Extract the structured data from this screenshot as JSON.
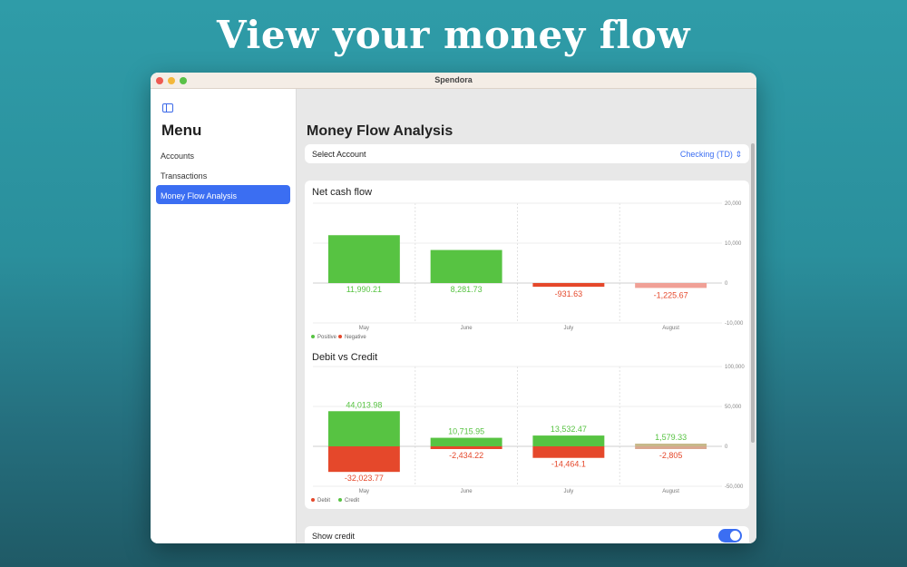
{
  "headline": "View your money flow",
  "window": {
    "title": "Spendora"
  },
  "sidebar": {
    "heading": "Menu",
    "items": [
      {
        "label": "Accounts"
      },
      {
        "label": "Transactions"
      },
      {
        "label": "Money Flow Analysis",
        "active": true
      }
    ]
  },
  "main": {
    "title": "Money Flow Analysis",
    "select_account": {
      "label": "Select Account",
      "value": "Checking (TD)"
    },
    "show_credit": {
      "label": "Show credit",
      "on": true
    }
  },
  "colors": {
    "positive": "#57c342",
    "negative": "#e5482b",
    "negative_light": "#f0a096",
    "accent": "#3b6ef2"
  },
  "chart_data": [
    {
      "type": "bar",
      "title": "Net cash flow",
      "categories": [
        "May",
        "June",
        "July",
        "August"
      ],
      "series": [
        {
          "name": "Net",
          "values": [
            11990.21,
            8281.73,
            -931.63,
            -1225.67
          ],
          "labels": [
            "11,990.21",
            "8,281.73",
            "-931.63",
            "-1,225.67"
          ]
        }
      ],
      "y_ticks": [
        20000,
        10000,
        0,
        -10000
      ],
      "y_tick_labels": [
        "20,000",
        "10,000",
        "0",
        "-10,000"
      ],
      "ylim": [
        -10000,
        20000
      ],
      "legend": [
        {
          "name": "Positive",
          "color": "#57c342"
        },
        {
          "name": "Negative",
          "color": "#e5482b"
        }
      ],
      "legend_position": "bottom-left",
      "grid": true
    },
    {
      "type": "bar",
      "title": "Debit vs Credit",
      "categories": [
        "May",
        "June",
        "July",
        "August"
      ],
      "series": [
        {
          "name": "Credit",
          "values": [
            44013.98,
            10715.95,
            13532.47,
            1579.33
          ],
          "labels": [
            "44,013.98",
            "10,715.95",
            "13,532.47",
            "1,579.33"
          ]
        },
        {
          "name": "Debit",
          "values": [
            -32023.77,
            -2434.22,
            -14464.1,
            -2805
          ],
          "labels": [
            "-32,023.77",
            "-2,434.22",
            "-14,464.1",
            "-2,805"
          ]
        }
      ],
      "y_ticks": [
        100000,
        50000,
        0,
        -50000
      ],
      "y_tick_labels": [
        "100,000",
        "50,000",
        "0",
        "-50,000"
      ],
      "ylim": [
        -50000,
        100000
      ],
      "legend": [
        {
          "name": "Debit",
          "color": "#e5482b"
        },
        {
          "name": "Credit",
          "color": "#57c342"
        }
      ],
      "legend_position": "bottom-left",
      "grid": true
    }
  ]
}
